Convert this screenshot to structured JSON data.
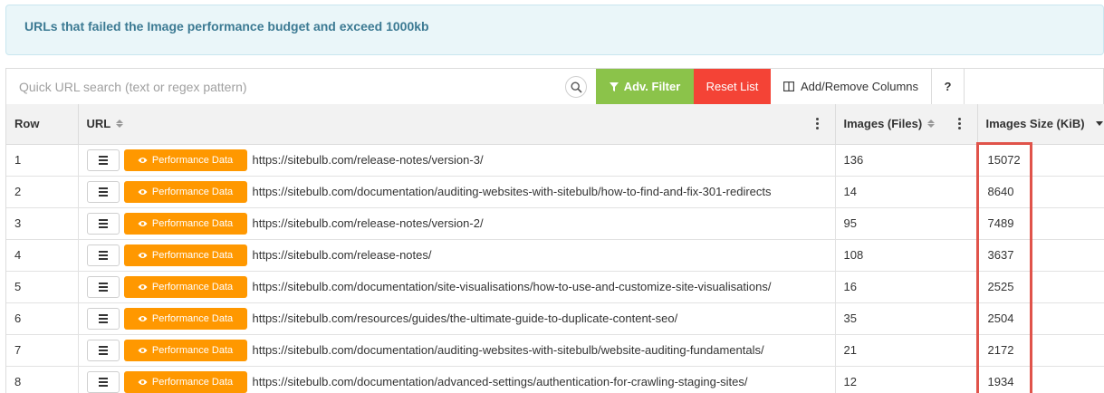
{
  "banner": {
    "text": "URLs that failed the Image performance budget and exceed 1000kb"
  },
  "toolbar": {
    "search_placeholder": "Quick URL search (text or regex pattern)",
    "adv_filter_label": "Adv. Filter",
    "reset_label": "Reset List",
    "columns_label": "Add/Remove Columns",
    "help_label": "?"
  },
  "table": {
    "headers": {
      "row": "Row",
      "url": "URL",
      "files": "Images (Files)",
      "size": "Images Size (KiB)"
    },
    "badge_label": "Performance Data",
    "rows": [
      {
        "row": "1",
        "url": "https://sitebulb.com/release-notes/version-3/",
        "files": "136",
        "size": "15072"
      },
      {
        "row": "2",
        "url": "https://sitebulb.com/documentation/auditing-websites-with-sitebulb/how-to-find-and-fix-301-redirects",
        "files": "14",
        "size": "8640"
      },
      {
        "row": "3",
        "url": "https://sitebulb.com/release-notes/version-2/",
        "files": "95",
        "size": "7489"
      },
      {
        "row": "4",
        "url": "https://sitebulb.com/release-notes/",
        "files": "108",
        "size": "3637"
      },
      {
        "row": "5",
        "url": "https://sitebulb.com/documentation/site-visualisations/how-to-use-and-customize-site-visualisations/",
        "files": "16",
        "size": "2525"
      },
      {
        "row": "6",
        "url": "https://sitebulb.com/resources/guides/the-ultimate-guide-to-duplicate-content-seo/",
        "files": "35",
        "size": "2504"
      },
      {
        "row": "7",
        "url": "https://sitebulb.com/documentation/auditing-websites-with-sitebulb/website-auditing-fundamentals/",
        "files": "21",
        "size": "2172"
      },
      {
        "row": "8",
        "url": "https://sitebulb.com/documentation/advanced-settings/authentication-for-crawling-staging-sites/",
        "files": "12",
        "size": "1934"
      }
    ]
  },
  "colors": {
    "adv_filter": "#8bc34a",
    "reset": "#f44336",
    "badge": "#ff9800",
    "highlight": "#e0534a",
    "banner_bg": "#eaf6f9",
    "banner_text": "#3c7a93"
  },
  "icons": {
    "search": "search-icon",
    "filter": "filter-icon",
    "columns": "columns-icon",
    "eye": "eye-icon",
    "menu": "hamburger-icon",
    "sort": "sort-icon",
    "kebab": "kebab-icon"
  }
}
